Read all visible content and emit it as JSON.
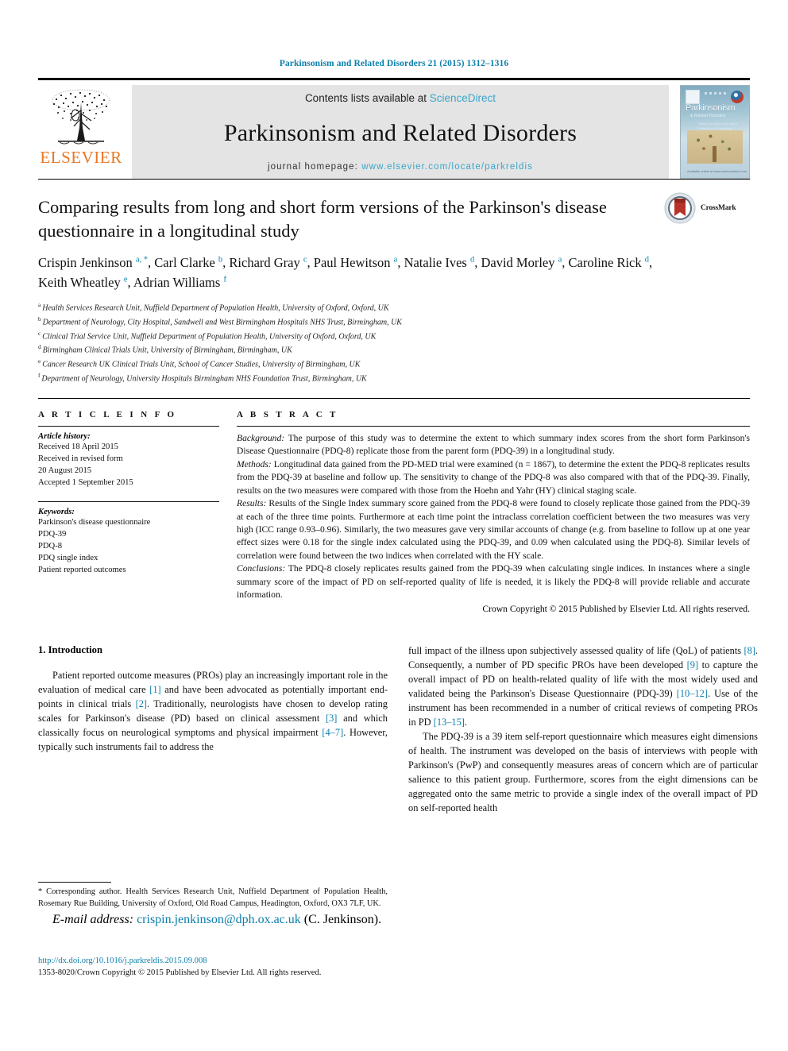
{
  "running_head": "Parkinsonism and Related Disorders 21 (2015) 1312–1316",
  "masthead": {
    "publisher_word": "ELSEVIER",
    "contents_prefix": "Contents lists available at ",
    "contents_link": "ScienceDirect",
    "journal_title": "Parkinsonism and Related Disorders",
    "homepage_prefix": "journal homepage: ",
    "homepage_link": "www.elsevier.com/locate/parkreldis",
    "cover": {
      "title": "Parkinsonism",
      "subtitle": "& Related Disorders",
      "blurb": "Official Journal of the World Federation of Neurology",
      "footer": "Available online at www.sciencedirect.com"
    }
  },
  "article": {
    "title": "Comparing results from long and short form versions of the Parkinson's disease questionnaire in a longitudinal study",
    "crossmark_label": "CrossMark",
    "authors": [
      {
        "name": "Crispin Jenkinson",
        "marks": "a, *",
        "sep": ", "
      },
      {
        "name": "Carl Clarke",
        "marks": "b",
        "sep": ", "
      },
      {
        "name": "Richard Gray",
        "marks": "c",
        "sep": ", "
      },
      {
        "name": "Paul Hewitson",
        "marks": "a",
        "sep": ", "
      },
      {
        "name": "Natalie Ives",
        "marks": "d",
        "sep": ", "
      },
      {
        "name": "David Morley",
        "marks": "a",
        "sep": ", "
      },
      {
        "name": "Caroline Rick",
        "marks": "d",
        "sep": ", "
      },
      {
        "name": "Keith Wheatley",
        "marks": "e",
        "sep": ", "
      },
      {
        "name": "Adrian Williams",
        "marks": "f",
        "sep": ""
      }
    ],
    "affiliations": [
      {
        "mark": "a",
        "text": "Health Services Research Unit, Nuffield Department of Population Health, University of Oxford, Oxford, UK"
      },
      {
        "mark": "b",
        "text": "Department of Neurology, City Hospital, Sandwell and West Birmingham Hospitals NHS Trust, Birmingham, UK"
      },
      {
        "mark": "c",
        "text": "Clinical Trial Service Unit, Nuffield Department of Population Health, University of Oxford, Oxford, UK"
      },
      {
        "mark": "d",
        "text": "Birmingham Clinical Trials Unit, University of Birmingham, Birmingham, UK"
      },
      {
        "mark": "e",
        "text": "Cancer Research UK Clinical Trials Unit, School of Cancer Studies, University of Birmingham, UK"
      },
      {
        "mark": "f",
        "text": "Department of Neurology, University Hospitals Birmingham NHS Foundation Trust, Birmingham, UK"
      }
    ]
  },
  "article_info": {
    "heading": "A R T I C L E  I N F O",
    "history_label": "Article history:",
    "history": [
      "Received 18 April 2015",
      "Received in revised form",
      "20 August 2015",
      "Accepted 1 September 2015"
    ],
    "keywords_label": "Keywords:",
    "keywords": [
      "Parkinson's disease questionnaire",
      "PDQ-39",
      "PDQ-8",
      "PDQ single index",
      "Patient reported outcomes"
    ]
  },
  "abstract": {
    "heading": "A B S T R A C T",
    "sections": [
      {
        "label": "Background:",
        "text": " The purpose of this study was to determine the extent to which summary index scores from the short form Parkinson's Disease Questionnaire (PDQ-8) replicate those from the parent form (PDQ-39) in a longitudinal study."
      },
      {
        "label": "Methods:",
        "text": " Longitudinal data gained from the PD-MED trial were examined (n = 1867), to determine the extent the PDQ-8 replicates results from the PDQ-39 at baseline and follow up. The sensitivity to change of the PDQ-8 was also compared with that of the PDQ-39. Finally, results on the two measures were compared with those from the Hoehn and Yahr (HY) clinical staging scale."
      },
      {
        "label": "Results:",
        "text": " Results of the Single Index summary score gained from the PDQ-8 were found to closely replicate those gained from the PDQ-39 at each of the three time points. Furthermore at each time point the intraclass correlation coefficient between the two measures was very high (ICC range 0.93–0.96). Similarly, the two measures gave very similar accounts of change (e.g. from baseline to follow up at one year effect sizes were 0.18 for the single index calculated using the PDQ-39, and 0.09 when calculated using the PDQ-8). Similar levels of correlation were found between the two indices when correlated with the HY scale."
      },
      {
        "label": "Conclusions:",
        "text": " The PDQ-8 closely replicates results gained from the PDQ-39 when calculating single indices. In instances where a single summary score of the impact of PD on self-reported quality of life is needed, it is likely the PDQ-8 will provide reliable and accurate information."
      }
    ],
    "copyright": "Crown Copyright © 2015 Published by Elsevier Ltd. All rights reserved."
  },
  "introduction": {
    "heading": "1. Introduction",
    "left_paragraph_parts": [
      "Patient reported outcome measures (PROs) play an increasingly important role in the evaluation of medical care ",
      "[1]",
      " and have been advocated as potentially important end-points in clinical trials ",
      "[2]",
      ". Traditionally, neurologists have chosen to develop rating scales for Parkinson's disease (PD) based on clinical assessment ",
      "[3]",
      " and which classically focus on neurological symptoms and physical impairment ",
      "[4–7]",
      ". However, typically such instruments fail to address the"
    ],
    "right_paragraph1_parts": [
      "full impact of the illness upon subjectively assessed quality of life (QoL) of patients ",
      "[8]",
      ". Consequently, a number of PD specific PROs have been developed ",
      "[9]",
      " to capture the overall impact of PD on health-related quality of life with the most widely used and validated being the Parkinson's Disease Questionnaire (PDQ-39) ",
      "[10–12]",
      ". Use of the instrument has been recommended in a number of critical reviews of competing PROs in PD ",
      "[13–15]",
      "."
    ],
    "right_paragraph2": "The PDQ-39 is a 39 item self-report questionnaire which measures eight dimensions of health. The instrument was developed on the basis of interviews with people with Parkinson's (PwP) and consequently measures areas of concern which are of particular salience to this patient group. Furthermore, scores from the eight dimensions can be aggregated onto the same metric to provide a single index of the overall impact of PD on self-reported health"
  },
  "footnote": {
    "corresponding": "* Corresponding author. Health Services Research Unit, Nuffield Department of Population Health, Rosemary Rue Building, University of Oxford, Old Road Campus, Headington, Oxford, OX3 7LF, UK.",
    "email_label": "E-mail address:",
    "email": "crispin.jenkinson@dph.ox.ac.uk",
    "email_owner": "(C. Jenkinson)."
  },
  "footer": {
    "doi": "http://dx.doi.org/10.1016/j.parkreldis.2015.09.008",
    "issn_line": "1353-8020/Crown Copyright © 2015 Published by Elsevier Ltd. All rights reserved."
  },
  "colors": {
    "link": "#0b7fab",
    "masthead_link": "#3aa6c9",
    "elsevier_orange": "#E87722",
    "masthead_bg": "#e4e4e4"
  }
}
